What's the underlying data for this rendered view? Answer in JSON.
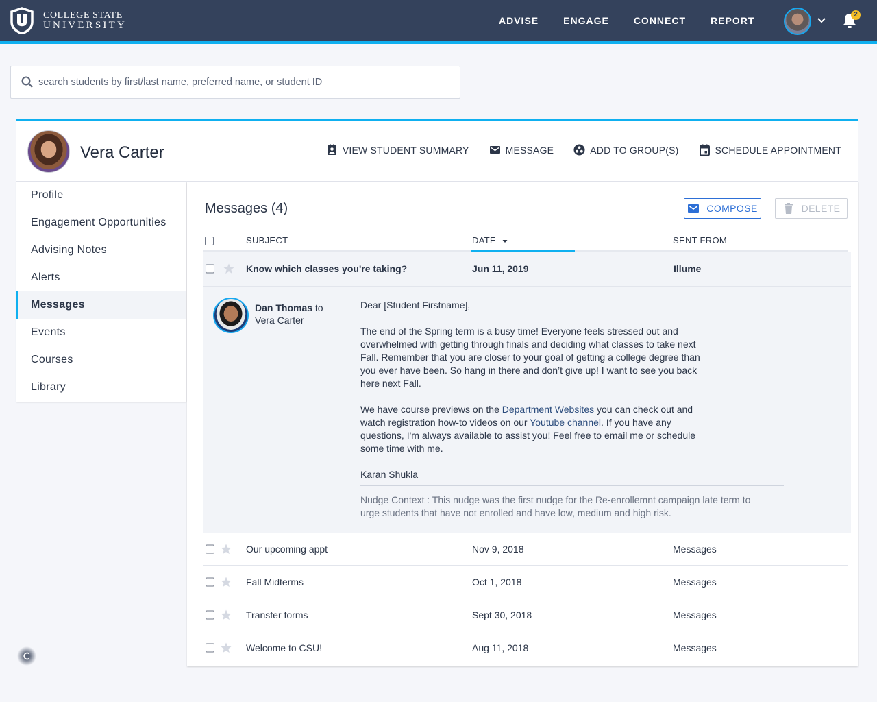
{
  "brand": {
    "line1": "COLLEGE STATE",
    "line2": "UNIVERSITY",
    "accent": "#0fb0f0",
    "nav_bg": "#34425c"
  },
  "nav": {
    "items": [
      "ADVISE",
      "ENGAGE",
      "CONNECT",
      "REPORT"
    ],
    "notification_count": "2"
  },
  "search": {
    "placeholder": "search students by first/last name, preferred name, or student ID",
    "value": ""
  },
  "student": {
    "name": "Vera Carter",
    "actions": [
      "VIEW STUDENT SUMMARY",
      "MESSAGE",
      "ADD TO GROUP(S)",
      "SCHEDULE APPOINTMENT"
    ]
  },
  "sidebar": {
    "items": [
      "Profile",
      "Engagement Opportunities",
      "Advising Notes",
      "Alerts",
      "Messages",
      "Events",
      "Courses",
      "Library"
    ],
    "active": "Messages"
  },
  "messages": {
    "title": "Messages (4)",
    "compose_label": "COMPOSE",
    "delete_label": "DELETE",
    "columns": {
      "subject": "SUBJECT",
      "date": "DATE",
      "sent_from": "SENT FROM"
    },
    "rows": [
      {
        "subject": "Know which classes you're taking?",
        "date": "Jun 11, 2019",
        "sent_from": "Illume"
      },
      {
        "subject": "Our upcoming appt",
        "date": "Nov 9, 2018",
        "sent_from": "Messages"
      },
      {
        "subject": "Fall Midterms",
        "date": "Oct 1, 2018",
        "sent_from": "Messages"
      },
      {
        "subject": "Transfer forms",
        "date": "Sept 30, 2018",
        "sent_from": "Messages"
      },
      {
        "subject": "Welcome to CSU!",
        "date": "Aug 11, 2018",
        "sent_from": "Messages"
      }
    ],
    "open_message": {
      "sender": "Dan Thomas",
      "to_word": "to",
      "recipient": "Vera Carter",
      "greeting": "Dear [Student Firstname],",
      "paragraph1": "The end of the Spring term is a busy time! Everyone feels stressed out and overwhelmed with getting through finals and deciding what classes to take next Fall. Remember that you are closer to your goal of getting a college degree than you ever have been. So hang in there and don’t give up! I want to see you back here next Fall.",
      "p2_a": "We have course previews on the ",
      "p2_link1": "Department Websites",
      "p2_b": " you can check out and watch registration how-to videos on our ",
      "p2_link2": "Youtube channel",
      "p2_c": ". If you have any questions, I'm always available to assist you! Feel free to email me or schedule some time with me.",
      "signature": "Karan Shukla",
      "nudge_context": "Nudge Context : This nudge was the first nudge for the Re-enrollemnt campaign late term to urge students that have not enrolled and have low, medium and high risk."
    }
  }
}
